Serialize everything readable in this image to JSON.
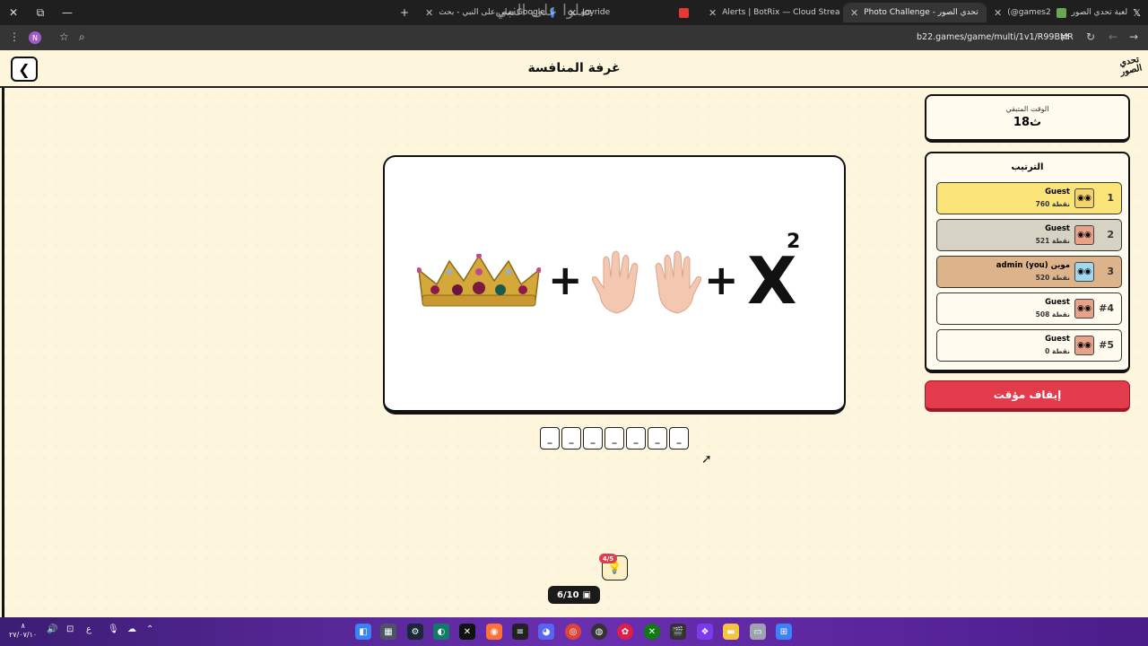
{
  "browser": {
    "tabs": [
      {
        "title": "صلي على النبي - بحث Google",
        "icon_color": "#4285f4"
      },
      {
        "title": "Joyride",
        "icon_color": "#888888"
      },
      {
        "title": "Alerts | BotRix — Cloud Stream",
        "icon_color": "#e53935"
      },
      {
        "title": "Photo Challenge - تحدي الصور",
        "icon_color": "#f1c232",
        "active": true
      },
      {
        "title": "لعبة تحدي الصور",
        "icon_color": "#f1c232"
      },
      {
        "title": "(@games2",
        "icon_color": "#ffffff"
      }
    ],
    "watermark": "صلوا على النبي",
    "url": "b22.games/game/multi/1v1/R99BMR",
    "profile_initial": "N"
  },
  "header": {
    "title": "غرفة المنافسة",
    "logo_line1": "تحدي",
    "logo_line2": "الصور"
  },
  "puzzle": {
    "operator_plus": "+",
    "variable": "X",
    "exponent": "2",
    "slots": [
      "_",
      "_",
      "_",
      "_",
      "_",
      "_",
      "_"
    ]
  },
  "timer": {
    "label": "الوقت المتبقي",
    "value": "18ث"
  },
  "ranking": {
    "title": "الترتيب",
    "players": [
      {
        "rank": "1",
        "name": "Guest",
        "score": "760 نقطة",
        "bg": "#fbe57a",
        "avatar_color": "#f6d36a"
      },
      {
        "rank": "2",
        "name": "Guest",
        "score": "521 نقطة",
        "bg": "#d6d2c4",
        "avatar_color": "#e8a28a"
      },
      {
        "rank": "3",
        "name": "admin (you) موين",
        "score": "520 نقطة",
        "bg": "#ddb38c",
        "avatar_color": "#9fd8ef"
      },
      {
        "rank": "#4",
        "name": "Guest",
        "score": "508 نقطة",
        "bg": "#fffbee",
        "avatar_color": "#e8a28a"
      },
      {
        "rank": "#5",
        "name": "Guest",
        "score": "0 نقطة",
        "bg": "#fffbee",
        "avatar_color": "#e8a28a"
      }
    ]
  },
  "controls": {
    "pause_label": "إيقاف مؤقت",
    "hints_badge": "4/5",
    "progress": "6/10"
  },
  "taskbar": {
    "time": "٨",
    "date": "٢٧/٠٧/١٠",
    "lang": "ع"
  }
}
